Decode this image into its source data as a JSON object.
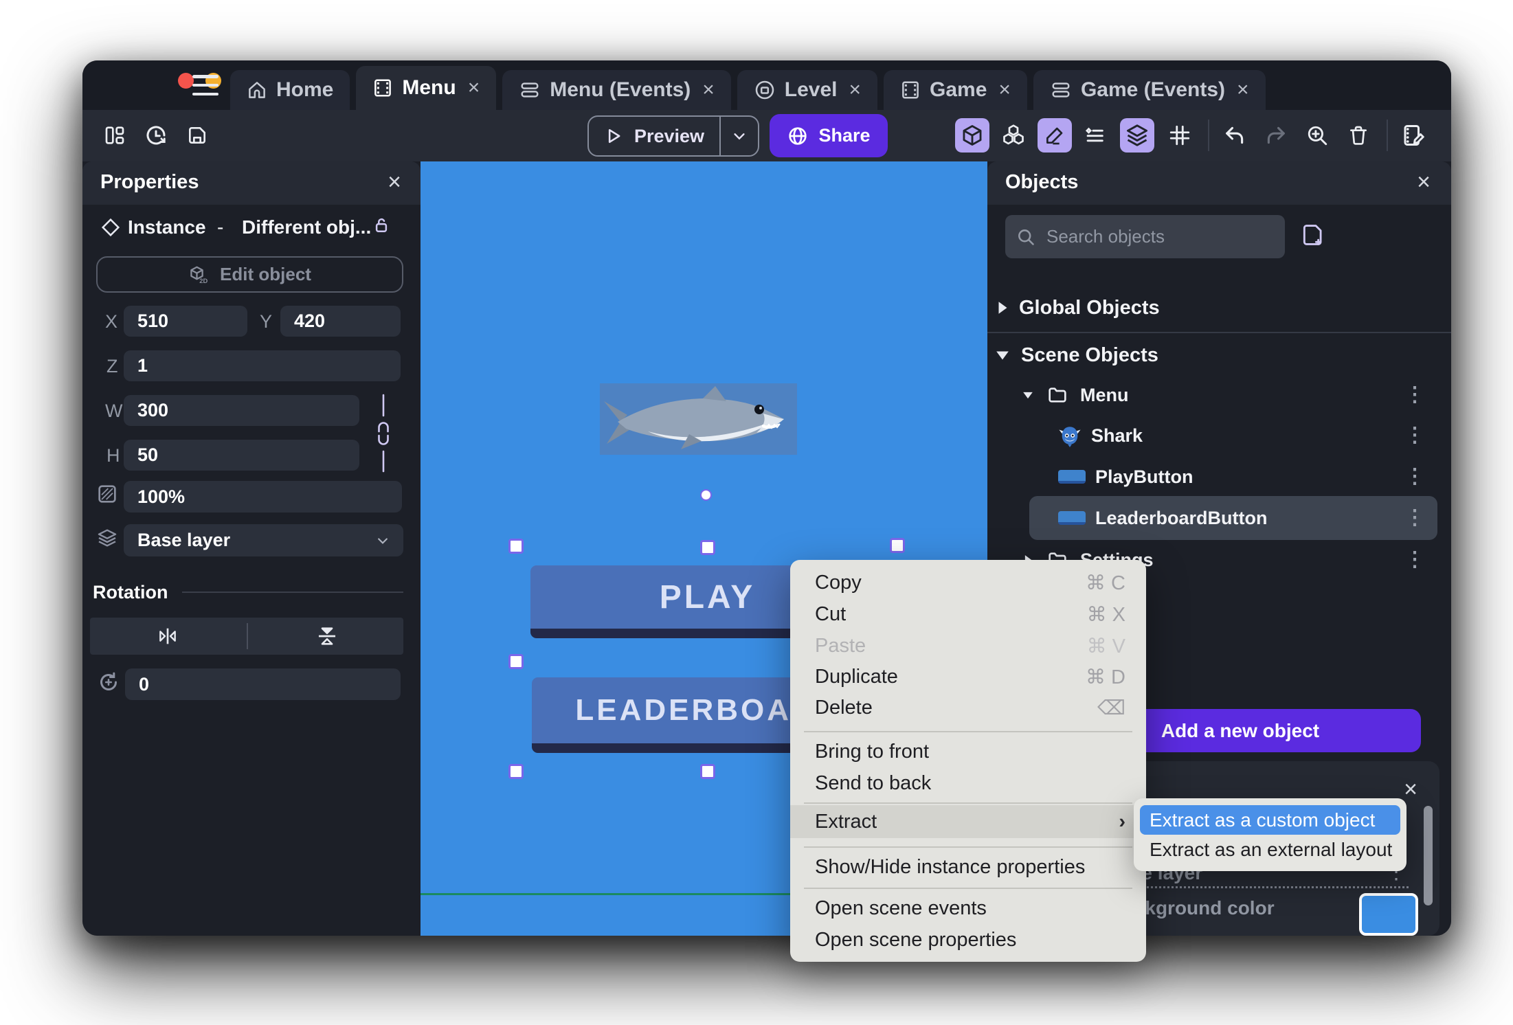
{
  "tabs": [
    {
      "label": "Home",
      "icon": "home-icon",
      "active": false,
      "closable": false
    },
    {
      "label": "Menu",
      "icon": "scene-icon",
      "active": true,
      "closable": true
    },
    {
      "label": "Menu (Events)",
      "icon": "events-icon",
      "active": false,
      "closable": true
    },
    {
      "label": "Level",
      "icon": "level-icon",
      "active": false,
      "closable": true
    },
    {
      "label": "Game",
      "icon": "scene-icon",
      "active": false,
      "closable": true
    },
    {
      "label": "Game (Events)",
      "icon": "events-icon",
      "active": false,
      "closable": true
    }
  ],
  "toolbar": {
    "preview": "Preview",
    "share": "Share",
    "left_icons": [
      "panels-layout-icon",
      "history-icon",
      "save-icon"
    ],
    "right_icons": [
      "object-cube-icon",
      "instances-icon",
      "edit-pencil-icon",
      "instance-properties-icon",
      "layers-icon",
      "grid-icon",
      "undo-icon",
      "redo-icon",
      "zoom-in-icon",
      "trash-icon",
      "scene-notes-icon"
    ],
    "highlighted_icons": [
      "object-cube-icon",
      "edit-pencil-icon",
      "layers-icon"
    ]
  },
  "properties": {
    "title": "Properties",
    "instance_type": "Instance",
    "dash": "-",
    "instance_name": "Different obj...",
    "edit_object": "Edit object",
    "x_label": "X",
    "x": "510",
    "y_label": "Y",
    "y": "420",
    "z_label": "Z",
    "z": "1",
    "w_label": "W",
    "w": "300",
    "h_label": "H",
    "h": "50",
    "opacity": "100%",
    "layer": "Base layer",
    "rotation_title": "Rotation",
    "rotation": "0"
  },
  "canvas": {
    "play": "PLAY",
    "leaderboard": "LEADERBOARD",
    "background_color": "#3a8de2"
  },
  "objects": {
    "title": "Objects",
    "search_placeholder": "Search objects",
    "global": "Global Objects",
    "scene": "Scene Objects",
    "folder_menu": "Menu",
    "shark": "Shark",
    "play_button": "PlayButton",
    "leaderboard_button": "LeaderboardButton",
    "settings": "Settings",
    "plus": "+",
    "add_button": "Add a new object"
  },
  "context_menu": {
    "items": [
      {
        "label": "Copy",
        "shortcut": "⌘ C"
      },
      {
        "label": "Cut",
        "shortcut": "⌘ X"
      },
      {
        "label": "Paste",
        "shortcut": "⌘ V",
        "disabled": true
      },
      {
        "label": "Duplicate",
        "shortcut": "⌘ D"
      },
      {
        "label": "Delete",
        "shortcut": "⌫"
      },
      {
        "label": "Bring to front"
      },
      {
        "label": "Send to back"
      },
      {
        "label": "Extract",
        "submenu": true,
        "hovered": true
      },
      {
        "label": "Show/Hide instance properties"
      },
      {
        "label": "Open scene events"
      },
      {
        "label": "Open scene properties"
      }
    ]
  },
  "submenu": {
    "items": [
      {
        "label": "Extract as a custom object",
        "selected": true
      },
      {
        "label": "Extract as an external layout",
        "selected": false
      }
    ]
  },
  "bottom_panel": {
    "layer": "Base layer",
    "background_color_label": "Background color",
    "background_color": "#3a8de2"
  },
  "colors": {
    "accent_purple": "#5b2be0",
    "toolbar_highlight": "#b4a5f2",
    "canvas_blue": "#3a8de2",
    "selection_purple": "#7a66ea",
    "submenu_highlight": "#4a90e8",
    "traffic_red": "#f4544c",
    "traffic_yellow": "#f5b02f",
    "traffic_green": "#27c93f"
  }
}
